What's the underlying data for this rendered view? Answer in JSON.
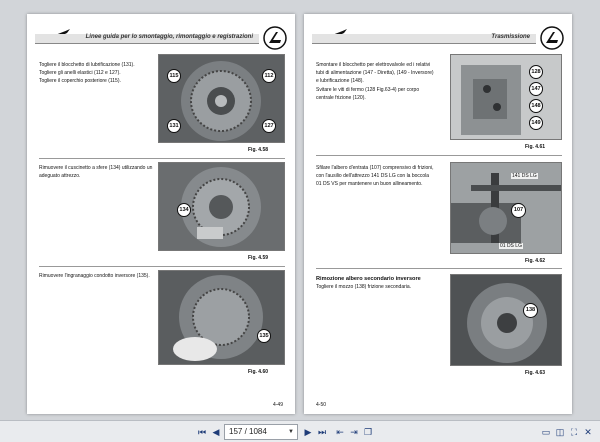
{
  "left_page": {
    "header": "Linee guida per lo smontaggio, rimontaggio e registrazioni",
    "sections": [
      {
        "lines": [
          "Togliere il blocchetto di lubrificazione (131).",
          "Togliere gli anelli elastici (112 e 127).",
          "Togliere il coperchio posteriore (115)."
        ],
        "figure": "Fig. 4.58",
        "callouts": [
          "115",
          "112",
          "131",
          "127"
        ]
      },
      {
        "lines": [
          "Rimuovere il cuscinetto a sfere (134) utilizzando un",
          "adeguato attrezzo."
        ],
        "figure": "Fig. 4.59",
        "callouts": [
          "134"
        ]
      },
      {
        "lines": [
          "Rimuovere l'ingranaggio condotto inversore (135)."
        ],
        "figure": "Fig. 4.60",
        "callouts": [
          "135"
        ]
      }
    ],
    "page_number": "4-49"
  },
  "right_page": {
    "header": "Trasmissione",
    "sections": [
      {
        "lines": [
          "Smontare il blocchetto per elettrovalvole ed i relativi",
          "tubi di alimentazione (147 - Diretta), (149 - Inversore)",
          "e lubrificazione (148).",
          "Svitare le viti di fermo (128 Fig.63-4) per corpo",
          "centrale frizione (120)."
        ],
        "figure": "Fig. 4.61",
        "callouts": [
          "128",
          "147",
          "148",
          "149"
        ]
      },
      {
        "lines": [
          "Sfilare l'albero d'entrata (107) comprensivo di frizioni,",
          "con l'ausilio dell'attrezzo 141 DS LG con la boccola",
          "01 DS VS per mantenere un buon allineamento."
        ],
        "figure": "Fig. 4.62",
        "callouts": [
          "107"
        ],
        "labels": [
          "141 DS LG",
          "01 DS LG"
        ]
      },
      {
        "heading": "Rimozione albero secondario inversore",
        "lines": [
          "Togliere il mozzo (138) frizione secondaria."
        ],
        "figure": "Fig. 4.63",
        "callouts": [
          "138"
        ]
      }
    ],
    "page_number": "4-50"
  },
  "toolbar": {
    "page_indicator": "157 / 1084",
    "icons": [
      "first-page-icon",
      "prev-page-icon",
      "dropdown-chevron-icon",
      "next-page-icon",
      "last-page-icon",
      "back-icon",
      "forward-icon",
      "copy-icon",
      "fit-page-icon",
      "two-page-icon",
      "fullscreen-icon",
      "close-icon"
    ]
  }
}
